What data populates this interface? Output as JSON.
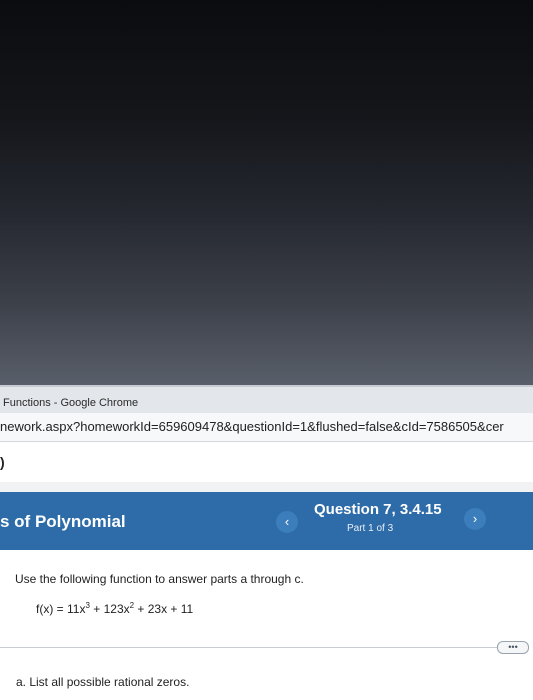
{
  "window": {
    "title": "Functions - Google Chrome"
  },
  "browser": {
    "url": "nework.aspx?homeworkId=659609478&questionId=1&flushed=false&cId=7586505&cer"
  },
  "app_header": {
    "text": ")"
  },
  "question_bar": {
    "topic": "s of Polynomial",
    "prev_icon": "‹",
    "next_icon": "›",
    "question_title": "Question 7, 3.4.15",
    "part_label": "Part 1 of 3"
  },
  "content": {
    "instructions": "Use the following function to answer parts a through c.",
    "function_prefix": "f(x) = 11x",
    "exp1": "3",
    "function_mid": " + 123x",
    "exp2": "2",
    "function_suffix": " + 23x + 11",
    "more_label": "•••",
    "part_a": "a. List all possible rational zeros."
  },
  "colors": {
    "question_bar": "#2d6ca8",
    "background_dark": "#0c0d10"
  }
}
